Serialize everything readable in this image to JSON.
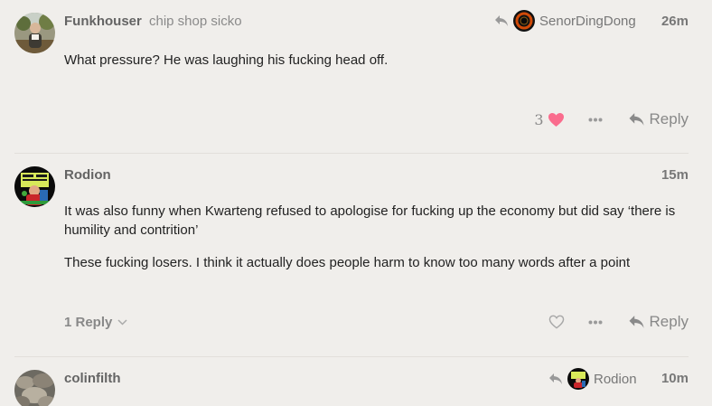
{
  "posts": [
    {
      "username": "Funkhouser",
      "user_title": "chip shop sicko",
      "reply_to_user": "SenorDingDong",
      "date": "26m",
      "paragraphs": [
        "What pressure? He was laughing his fucking head off."
      ],
      "like_count": "3",
      "reply_label": "Reply"
    },
    {
      "username": "Rodion",
      "date": "15m",
      "paragraphs": [
        "It was also funny when Kwarteng refused to apologise for fucking up the economy but did say ‘there is humility and contrition’",
        "These fucking losers. I think it actually does people harm to know too many words after a point"
      ],
      "replies_label": "1 Reply",
      "reply_label": "Reply"
    },
    {
      "username": "colinfilth",
      "reply_to_user": "Rodion",
      "date": "10m"
    }
  ],
  "colors": {
    "background": "#f0eeeb",
    "text": "#222222",
    "muted": "#888888",
    "like_heart": "#fa6c8d"
  },
  "icons": [
    "reply-arrow-icon",
    "heart-icon",
    "heart-outline-icon",
    "ellipsis-icon",
    "chevron-down-icon"
  ]
}
